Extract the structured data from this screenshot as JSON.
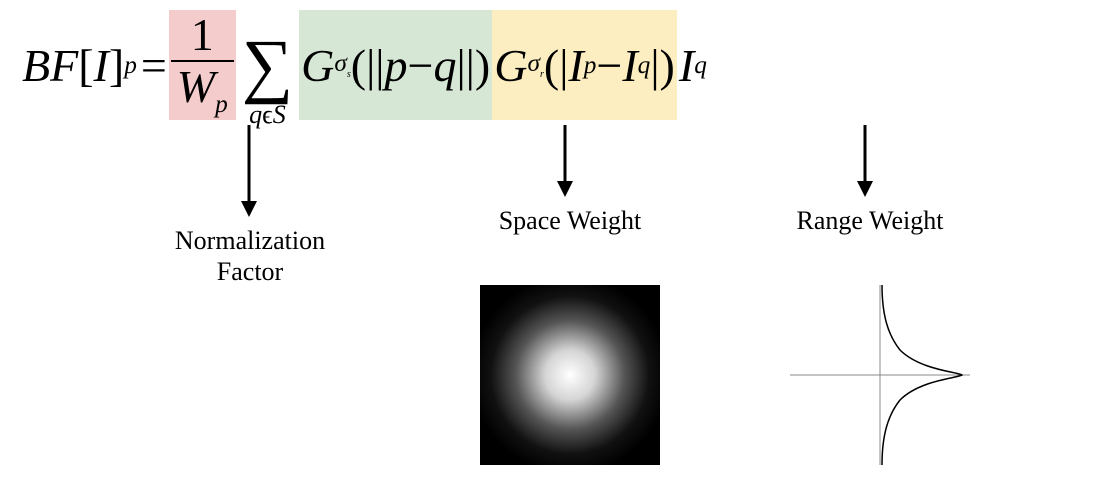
{
  "equation": {
    "lhs_BF": "BF",
    "lhs_open": "[",
    "lhs_I": "I",
    "lhs_close": "]",
    "lhs_sub_p": "p",
    "equals": " = ",
    "frac_num": "1",
    "frac_den_W": "W",
    "frac_den_sub": "p",
    "sum_symbol": "∑",
    "sum_sub_q": "q",
    "sum_sub_eps": "ϵ",
    "sum_sub_S": "S",
    "space_G": "G",
    "space_sigma": "σ",
    "space_sigma_sub": "s",
    "space_open": "(||",
    "space_p": "p",
    "space_minus": " − ",
    "space_q": "q",
    "space_close": "||)",
    "range_G": "G",
    "range_sigma": "σ",
    "range_sigma_sub": "r",
    "range_open": "(|",
    "range_Ip_I": "I",
    "range_Ip_sub": "p",
    "range_minus": " − ",
    "range_Iq_I": "I",
    "range_Iq_sub": "q",
    "range_close": "|)",
    "tail_I": "I",
    "tail_sub": "q"
  },
  "annotations": {
    "normalization": "Normalization\nFactor",
    "space": "Space Weight",
    "range": "Range Weight"
  }
}
